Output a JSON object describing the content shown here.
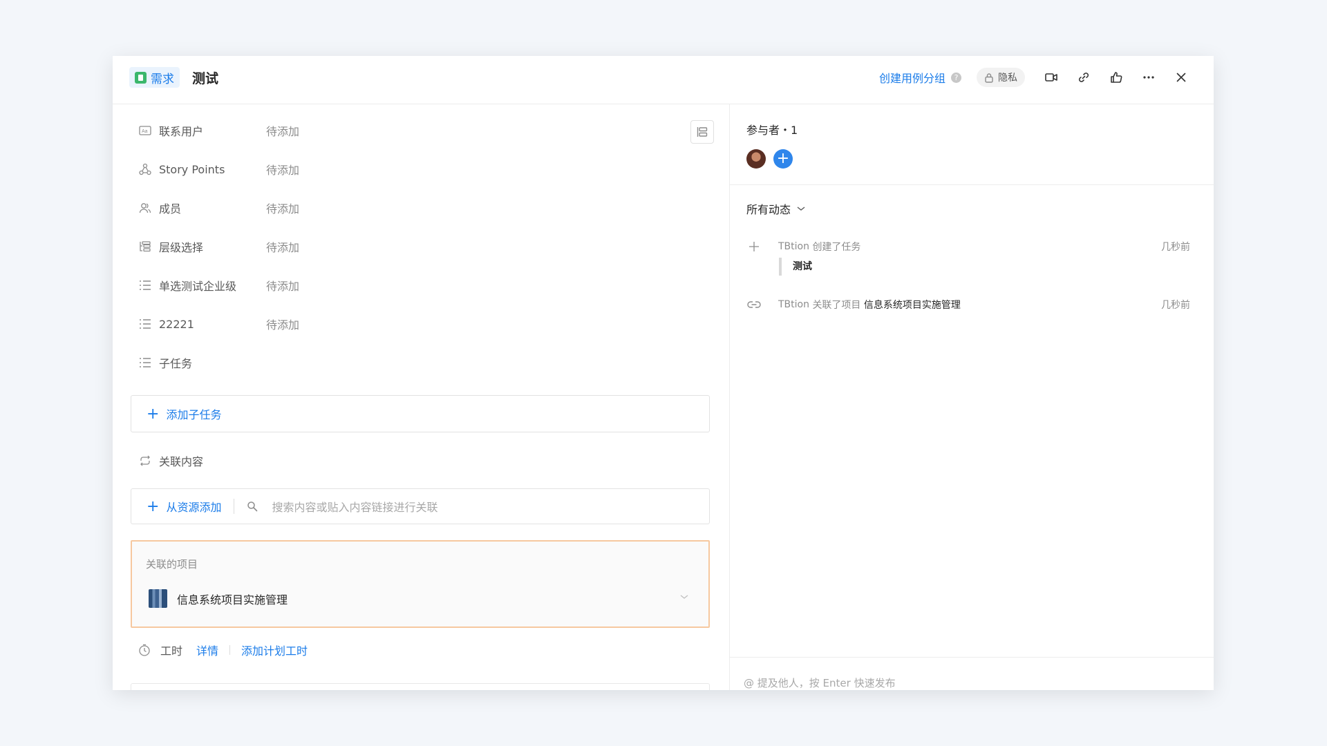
{
  "header": {
    "type_label": "需求",
    "title": "测试",
    "create_group": "创建用例分组",
    "help": "?",
    "privacy": "隐私"
  },
  "fields": [
    {
      "label": "联系用户",
      "value": "待添加",
      "icon": "contact-card-icon"
    },
    {
      "label": "Story Points",
      "value": "待添加",
      "icon": "story-points-icon"
    },
    {
      "label": "成员",
      "value": "待添加",
      "icon": "members-icon"
    },
    {
      "label": "层级选择",
      "value": "待添加",
      "icon": "hierarchy-icon"
    },
    {
      "label": "单选测试企业级",
      "value": "待添加",
      "icon": "list-icon"
    },
    {
      "label": "22221",
      "value": "待添加",
      "icon": "list-icon"
    },
    {
      "label": "子任务",
      "value": "",
      "icon": "subtask-list-icon"
    }
  ],
  "subtask": {
    "add_label": "添加子任务"
  },
  "related": {
    "label": "关联内容",
    "add_from_resource": "从资源添加",
    "search_placeholder": "搜索内容或贴入内容链接进行关联",
    "project_section": "关联的项目",
    "project_name": "信息系统项目实施管理"
  },
  "worktime": {
    "label": "工时",
    "details": "详情",
    "add_plan": "添加计划工时"
  },
  "participants": {
    "title": "参与者・1",
    "add": "+"
  },
  "activity": {
    "filter": "所有动态",
    "items": [
      {
        "actor": "TBtion",
        "action": "创建了任务",
        "time": "几秒前",
        "quote": "测试"
      },
      {
        "actor": "TBtion",
        "action": "关联了项目",
        "target": "信息系统项目实施管理",
        "time": "几秒前"
      }
    ]
  },
  "comment": {
    "placeholder": "@ 提及他人，按 Enter 快速发布"
  },
  "colors": {
    "accent": "#1b7ce9",
    "type_green": "#3bb76c",
    "highlight_border": "#f6c89f"
  }
}
